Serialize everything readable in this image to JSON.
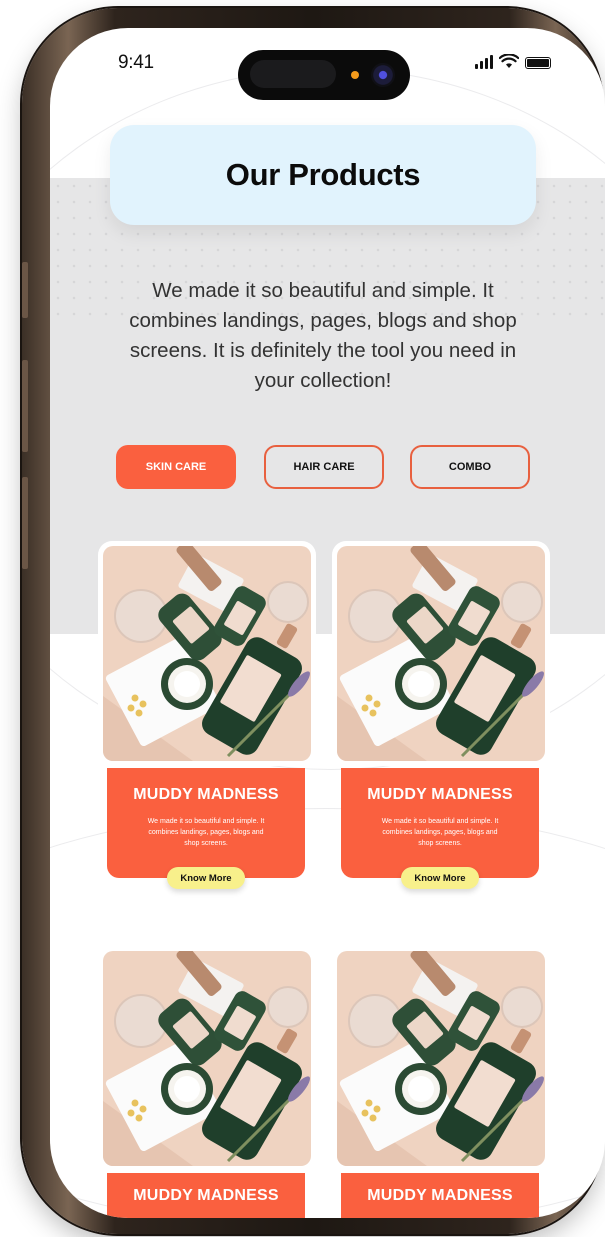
{
  "status_bar": {
    "time": "9:41"
  },
  "header": {
    "title": "Our Products"
  },
  "intro": {
    "text": "We made it so beautiful and simple. It combines landings, pages, blogs and shop screens. It is definitely the tool you need in your collection!"
  },
  "filters": [
    {
      "label": "SKIN CARE",
      "active": true
    },
    {
      "label": "HAIR CARE",
      "active": false
    },
    {
      "label": "COMBO",
      "active": false
    }
  ],
  "products": [
    {
      "name": "MUDDY MADNESS",
      "description": "We made it so beautiful and simple. It combines landings, pages, blogs and shop screens.",
      "cta": "Know More"
    },
    {
      "name": "MUDDY MADNESS",
      "description": "We made it so beautiful and simple. It combines landings, pages, blogs and shop screens.",
      "cta": "Know More"
    },
    {
      "name": "MUDDY MADNESS"
    },
    {
      "name": "MUDDY MADNESS"
    }
  ],
  "colors": {
    "accent": "#fa603f",
    "cta": "#f8f08b",
    "title_card": "#e1f3fd",
    "band": "#e6e6e7"
  },
  "icons": [
    "signal-icon",
    "wifi-icon",
    "battery-icon"
  ]
}
